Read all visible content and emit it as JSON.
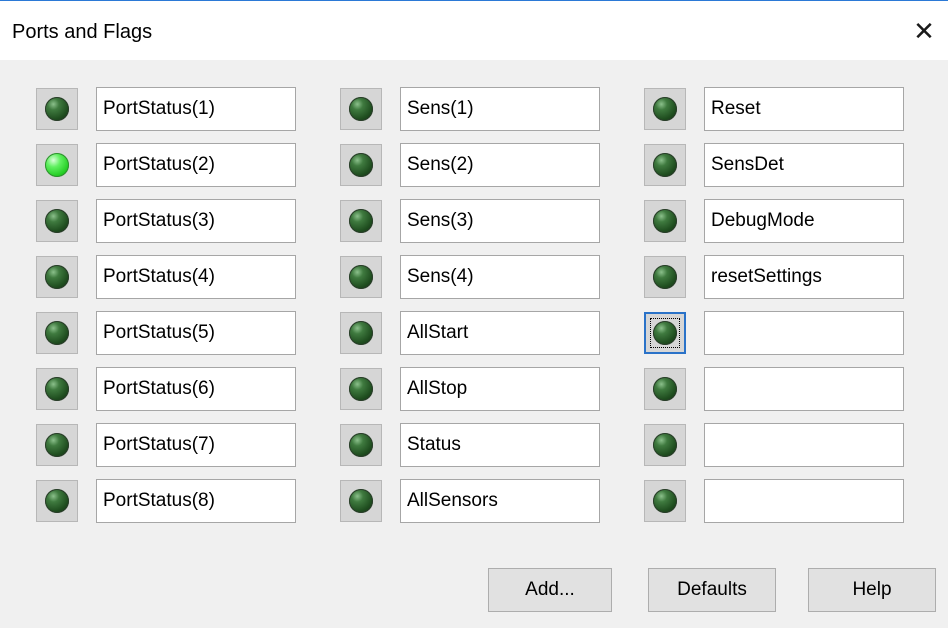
{
  "window": {
    "title": "Ports and Flags",
    "close_glyph": "✕"
  },
  "columns": [
    {
      "rows": [
        {
          "label": "PortStatus(1)",
          "led_on": false
        },
        {
          "label": "PortStatus(2)",
          "led_on": true
        },
        {
          "label": "PortStatus(3)",
          "led_on": false
        },
        {
          "label": "PortStatus(4)",
          "led_on": false
        },
        {
          "label": "PortStatus(5)",
          "led_on": false
        },
        {
          "label": "PortStatus(6)",
          "led_on": false
        },
        {
          "label": "PortStatus(7)",
          "led_on": false
        },
        {
          "label": "PortStatus(8)",
          "led_on": false
        }
      ]
    },
    {
      "rows": [
        {
          "label": "Sens(1)",
          "led_on": false
        },
        {
          "label": "Sens(2)",
          "led_on": false
        },
        {
          "label": "Sens(3)",
          "led_on": false
        },
        {
          "label": "Sens(4)",
          "led_on": false
        },
        {
          "label": "AllStart",
          "led_on": false
        },
        {
          "label": "AllStop",
          "led_on": false
        },
        {
          "label": "Status",
          "led_on": false
        },
        {
          "label": "AllSensors",
          "led_on": false
        }
      ]
    },
    {
      "rows": [
        {
          "label": "Reset",
          "led_on": false
        },
        {
          "label": "SensDet",
          "led_on": false
        },
        {
          "label": "DebugMode",
          "led_on": false
        },
        {
          "label": "resetSettings",
          "led_on": false
        },
        {
          "label": "",
          "led_on": false,
          "focused": true
        },
        {
          "label": "",
          "led_on": false
        },
        {
          "label": "",
          "led_on": false
        },
        {
          "label": "",
          "led_on": false
        }
      ]
    }
  ],
  "buttons": {
    "add": "Add...",
    "defaults": "Defaults",
    "help": "Help"
  },
  "colors": {
    "led_on": "#33dd33",
    "led_off": "#2a5a2a",
    "focus": "#2a72c8",
    "title_accent": "#2b79d6"
  }
}
